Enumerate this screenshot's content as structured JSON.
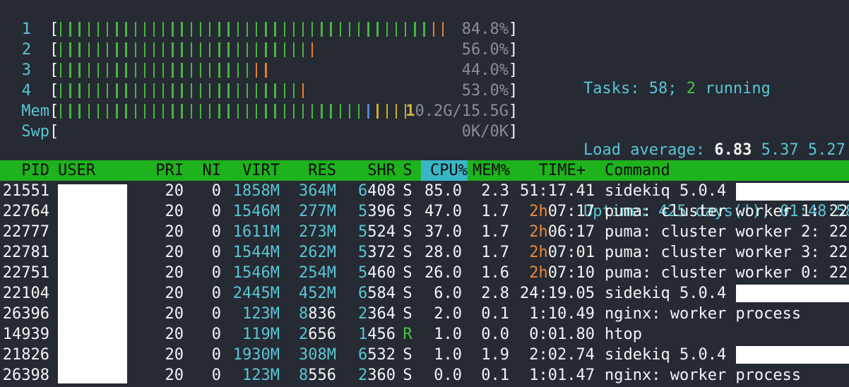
{
  "meters": [
    {
      "label": "1",
      "value": "84.8%",
      "green": 40,
      "orange": 2,
      "blue": 0,
      "yellow": 0
    },
    {
      "label": "2",
      "value": "56.0%",
      "green": 27,
      "orange": 1,
      "blue": 0,
      "yellow": 0
    },
    {
      "label": "3",
      "value": "44.0%",
      "green": 21,
      "orange": 2,
      "blue": 0,
      "yellow": 0
    },
    {
      "label": "4",
      "value": "53.0%",
      "green": 26,
      "orange": 1,
      "blue": 0,
      "yellow": 0
    },
    {
      "label": "Mem",
      "value": "10.2G/15.5G",
      "value_lead": "1",
      "value_rest": "0.2G/15.5G",
      "green": 33,
      "orange": 0,
      "blue": 1,
      "yellow": 4
    },
    {
      "label": "Swp",
      "value": "0K/0K",
      "green": 0,
      "orange": 0,
      "blue": 0,
      "yellow": 0
    }
  ],
  "summary": {
    "tasks_label": "Tasks: ",
    "tasks_total": "58",
    "tasks_sep": "; ",
    "tasks_running": "2",
    "tasks_running_label": " running",
    "load_label": "Load average: ",
    "load_1": "6.83",
    "load_5": "5.37",
    "load_15": "5.27",
    "uptime_label": "Uptime: ",
    "uptime_value": "425 days(!), 01:48:58"
  },
  "columns": {
    "pid": "PID",
    "user": "USER",
    "pri": "PRI",
    "ni": "NI",
    "virt": "VIRT",
    "res": "RES",
    "shr": "SHR",
    "s": "S",
    "cpu": "CPU%",
    "mem": "MEM%",
    "time": "TIME+",
    "command": "Command"
  },
  "processes": [
    {
      "pid": "21551",
      "pri": "20",
      "ni": "0",
      "virt": "1858M",
      "res": "364M",
      "shr_a": "6",
      "shr_b": "408",
      "s": "S",
      "cpu": "85.0",
      "mem": "2.3",
      "time_a": "",
      "time_b": "51:17.41",
      "cmd": "sidekiq 5.0.4"
    },
    {
      "pid": "22764",
      "pri": "20",
      "ni": "0",
      "virt": "1546M",
      "res": "277M",
      "shr_a": "5",
      "shr_b": "396",
      "s": "S",
      "cpu": "47.0",
      "mem": "1.7",
      "time_a": "2h",
      "time_b": "07:17",
      "cmd": "puma: cluster worker 1: 22"
    },
    {
      "pid": "22777",
      "pri": "20",
      "ni": "0",
      "virt": "1611M",
      "res": "273M",
      "shr_a": "5",
      "shr_b": "524",
      "s": "S",
      "cpu": "37.0",
      "mem": "1.7",
      "time_a": "2h",
      "time_b": "06:17",
      "cmd": "puma: cluster worker 2: 22"
    },
    {
      "pid": "22781",
      "pri": "20",
      "ni": "0",
      "virt": "1544M",
      "res": "262M",
      "shr_a": "5",
      "shr_b": "372",
      "s": "S",
      "cpu": "28.0",
      "mem": "1.7",
      "time_a": "2h",
      "time_b": "07:01",
      "cmd": "puma: cluster worker 3: 22"
    },
    {
      "pid": "22751",
      "pri": "20",
      "ni": "0",
      "virt": "1546M",
      "res": "254M",
      "shr_a": "5",
      "shr_b": "460",
      "s": "S",
      "cpu": "26.0",
      "mem": "1.6",
      "time_a": "2h",
      "time_b": "07:10",
      "cmd": "puma: cluster worker 0: 22"
    },
    {
      "pid": "22104",
      "pri": "20",
      "ni": "0",
      "virt": "2445M",
      "res": "452M",
      "shr_a": "6",
      "shr_b": "584",
      "s": "S",
      "cpu": "6.0",
      "mem": "2.8",
      "time_a": "",
      "time_b": "24:19.05",
      "cmd": "sidekiq 5.0.4"
    },
    {
      "pid": "26396",
      "pri": "20",
      "ni": "0",
      "virt": "123M",
      "res": "8836",
      "shr_a": "2",
      "shr_b": "364",
      "s": "S",
      "cpu": "2.0",
      "mem": "0.1",
      "time_a": "",
      "time_b": "1:10.49",
      "cmd": "nginx: worker process"
    },
    {
      "pid": "14939",
      "pri": "20",
      "ni": "0",
      "virt": "119M",
      "res": "2656",
      "shr_a": "1",
      "shr_b": "456",
      "s": "R",
      "cpu": "1.0",
      "mem": "0.0",
      "time_a": "",
      "time_b": "0:01.80",
      "cmd": "htop"
    },
    {
      "pid": "21826",
      "pri": "20",
      "ni": "0",
      "virt": "1930M",
      "res": "308M",
      "shr_a": "6",
      "shr_b": "532",
      "s": "S",
      "cpu": "1.0",
      "mem": "1.9",
      "time_a": "",
      "time_b": "2:02.74",
      "cmd": "sidekiq 5.0.4"
    },
    {
      "pid": "26398",
      "pri": "20",
      "ni": "0",
      "virt": "123M",
      "res": "8556",
      "shr_a": "2",
      "shr_b": "360",
      "s": "S",
      "cpu": "0.0",
      "mem": "0.1",
      "time_a": "",
      "time_b": "1:01.47",
      "cmd": "nginx: worker process"
    }
  ]
}
